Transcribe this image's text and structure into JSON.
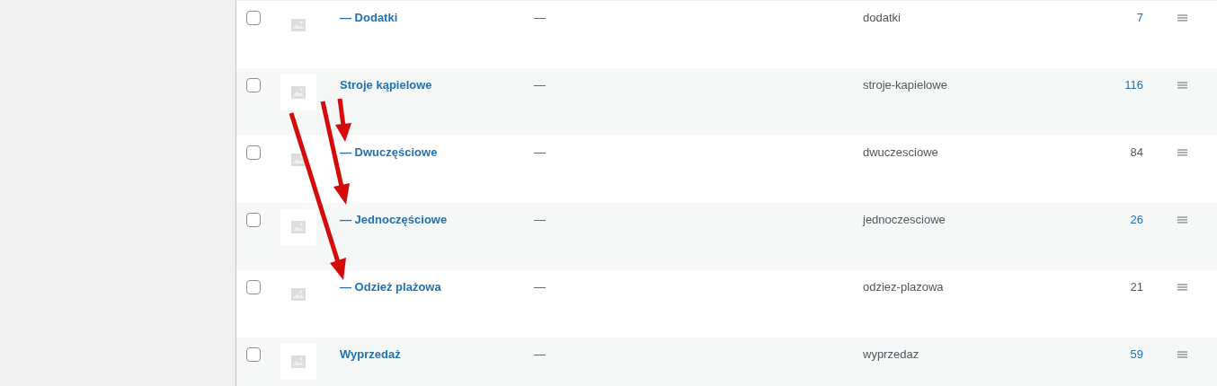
{
  "rows": [
    {
      "name": "— Dodatki",
      "description": "—",
      "slug": "dodatki",
      "count": "7",
      "color": "#2271b1",
      "checked": false
    },
    {
      "name": "Stroje kąpielowe",
      "description": "—",
      "slug": "stroje-kapielowe",
      "count": "116",
      "color": "#2271b1",
      "checked": false
    },
    {
      "name": "— Dwuczęściowe",
      "description": "—",
      "slug": "dwuczesciowe",
      "count": "84",
      "color": "#50575e",
      "checked": false
    },
    {
      "name": "— Jednoczęściowe",
      "description": "—",
      "slug": "jednoczesciowe",
      "count": "26",
      "color": "#2271b1",
      "checked": false
    },
    {
      "name": "— Odzież plażowa",
      "description": "—",
      "slug": "odziez-plazowa",
      "count": "21",
      "color": "#50575e",
      "checked": false
    },
    {
      "name": "Wyprzedaż",
      "description": "—",
      "slug": "wyprzedaz",
      "count": "59",
      "color": "#2271b1",
      "checked": false
    }
  ]
}
